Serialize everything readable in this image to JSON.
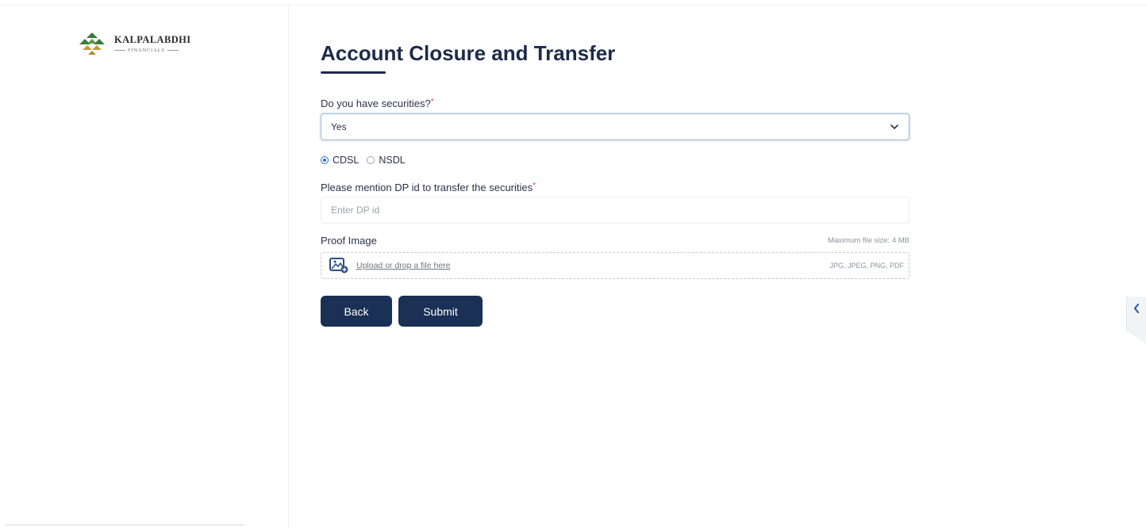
{
  "brand": {
    "name": "KALPALABDHI",
    "sub": "FINANCIALS",
    "colors": {
      "leaf_green": "#3d7a3a",
      "leaf_gold": "#c59a3a"
    }
  },
  "form": {
    "title": "Account Closure and Transfer",
    "securities": {
      "label": "Do you have securities?",
      "required_mark": "*",
      "selected_value": "Yes"
    },
    "depository": {
      "options": [
        {
          "label": "CDSL",
          "checked": true
        },
        {
          "label": "NSDL",
          "checked": false
        }
      ]
    },
    "dp_id": {
      "label": "Please mention DP id to transfer the securities",
      "required_mark": "*",
      "placeholder": "Enter DP id",
      "value": ""
    },
    "proof_image": {
      "label": "Proof Image",
      "max_size": "Maximum file size: 4 MB",
      "upload_text": "Upload or drop a file here",
      "file_types": "JPG, JPEG, PNG, PDF"
    },
    "buttons": {
      "back": "Back",
      "submit": "Submit"
    }
  },
  "theme": {
    "primary": "#1a3054",
    "accent_blue": "#2f6fd1",
    "border": "#eceef2"
  },
  "icons": {
    "select_chevron": "chevron-down-icon",
    "upload": "image-upload-icon",
    "edge_tab": "chevron-left-icon"
  }
}
